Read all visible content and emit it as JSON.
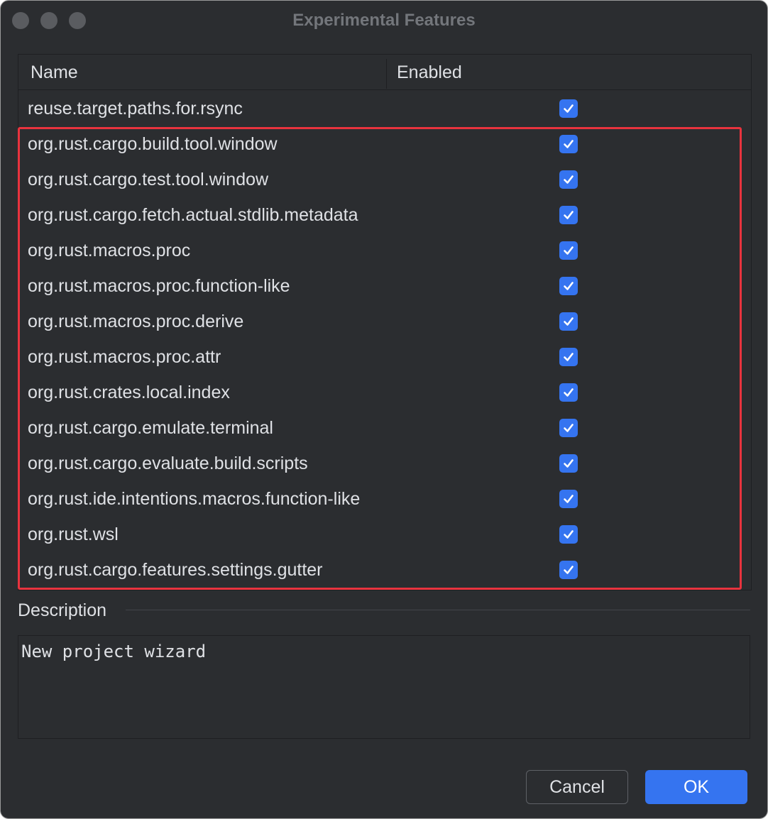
{
  "window": {
    "title": "Experimental Features"
  },
  "table": {
    "headers": {
      "name": "Name",
      "enabled": "Enabled"
    },
    "rows": [
      {
        "name": "reuse.target.paths.for.rsync",
        "enabled": true
      },
      {
        "name": "org.rust.cargo.build.tool.window",
        "enabled": true
      },
      {
        "name": "org.rust.cargo.test.tool.window",
        "enabled": true
      },
      {
        "name": "org.rust.cargo.fetch.actual.stdlib.metadata",
        "enabled": true
      },
      {
        "name": "org.rust.macros.proc",
        "enabled": true
      },
      {
        "name": "org.rust.macros.proc.function-like",
        "enabled": true
      },
      {
        "name": "org.rust.macros.proc.derive",
        "enabled": true
      },
      {
        "name": "org.rust.macros.proc.attr",
        "enabled": true
      },
      {
        "name": "org.rust.crates.local.index",
        "enabled": true
      },
      {
        "name": "org.rust.cargo.emulate.terminal",
        "enabled": true
      },
      {
        "name": "org.rust.cargo.evaluate.build.scripts",
        "enabled": true
      },
      {
        "name": "org.rust.ide.intentions.macros.function-like",
        "enabled": true
      },
      {
        "name": "org.rust.wsl",
        "enabled": true
      },
      {
        "name": "org.rust.cargo.features.settings.gutter",
        "enabled": true
      }
    ]
  },
  "description": {
    "label": "Description",
    "text": "New project wizard"
  },
  "buttons": {
    "cancel": "Cancel",
    "ok": "OK"
  },
  "colors": {
    "accent": "#3574f0",
    "highlight": "#e8333e",
    "background": "#2b2d30"
  },
  "icons": {
    "checkbox": "checkmark-icon"
  }
}
